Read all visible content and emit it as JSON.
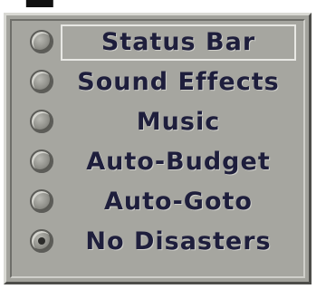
{
  "options_panel": {
    "options": [
      {
        "label": "Status Bar",
        "checked": false,
        "focused": true
      },
      {
        "label": "Sound Effects",
        "checked": false,
        "focused": false
      },
      {
        "label": "Music",
        "checked": false,
        "focused": false
      },
      {
        "label": "Auto-Budget",
        "checked": false,
        "focused": false
      },
      {
        "label": "Auto-Goto",
        "checked": false,
        "focused": false
      },
      {
        "label": "No Disasters",
        "checked": true,
        "focused": false
      }
    ]
  },
  "colors": {
    "panel_bg": "#a6a6a0",
    "label_text": "#1e1e3c",
    "radio_selected_dot": "#2c2c2a"
  }
}
